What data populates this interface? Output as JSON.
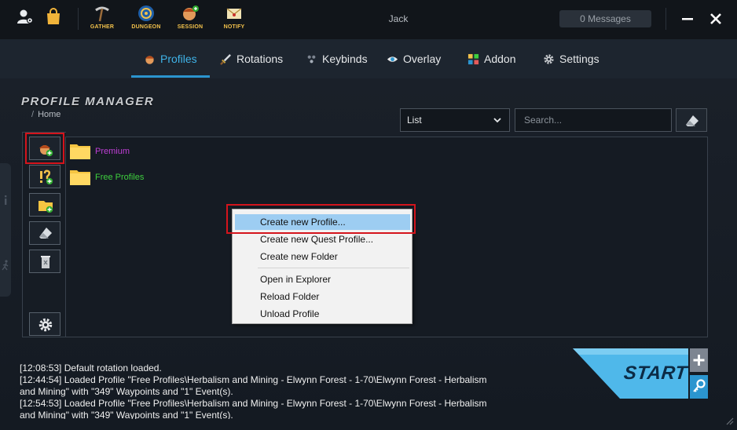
{
  "window": {
    "user_name": "Jack",
    "messages_label": "0 Messages"
  },
  "apps": [
    {
      "label": "GATHER",
      "icon": "pickaxe-icon"
    },
    {
      "label": "DUNGEON",
      "icon": "dungeon-icon"
    },
    {
      "label": "SESSION",
      "icon": "session-icon"
    },
    {
      "label": "NOTIFY",
      "icon": "notify-icon"
    }
  ],
  "tabs": [
    {
      "label": "Profiles",
      "icon": "profiles-icon",
      "active": true
    },
    {
      "label": "Rotations",
      "icon": "sword-icon"
    },
    {
      "label": "Keybinds",
      "icon": "keybinds-icon"
    },
    {
      "label": "Overlay",
      "icon": "eye-icon"
    },
    {
      "label": "Addon",
      "icon": "addon-icon"
    },
    {
      "label": "Settings",
      "icon": "gear-icon"
    }
  ],
  "page": {
    "title": "PROFILE MANAGER",
    "breadcrumb_sep": "/",
    "breadcrumb": "Home",
    "view_select": "List",
    "search_placeholder": "Search..."
  },
  "folders": [
    {
      "name": "Premium",
      "color": "#c03fd6"
    },
    {
      "name": "Free Profiles",
      "color": "#3ecf3e"
    }
  ],
  "context_menu": {
    "items": [
      {
        "label": "Create new Profile...",
        "selected": true
      },
      {
        "label": "Create new Quest Profile..."
      },
      {
        "label": "Create new Folder"
      },
      {
        "label": "Open in Explorer"
      },
      {
        "label": "Reload Folder"
      },
      {
        "label": "Unload Profile"
      }
    ]
  },
  "log": [
    "[12:08:53] Default rotation loaded.",
    "[12:44:54] Loaded Profile \"Free Profiles\\Herbalism and Mining - Elwynn Forest - 1-70\\Elwynn Forest - Herbalism and Mining\" with \"349\" Waypoints and \"1\" Event(s).",
    "[12:54:53] Loaded Profile \"Free Profiles\\Herbalism and Mining - Elwynn Forest - 1-70\\Elwynn Forest - Herbalism and Mining\" with \"349\" Waypoints and \"1\" Event(s)."
  ],
  "start_label": "START",
  "colors": {
    "accent": "#2b95cf",
    "start": "#4fb8ea",
    "highlight_red": "#d4141c",
    "app_label": "#f2c14b"
  }
}
